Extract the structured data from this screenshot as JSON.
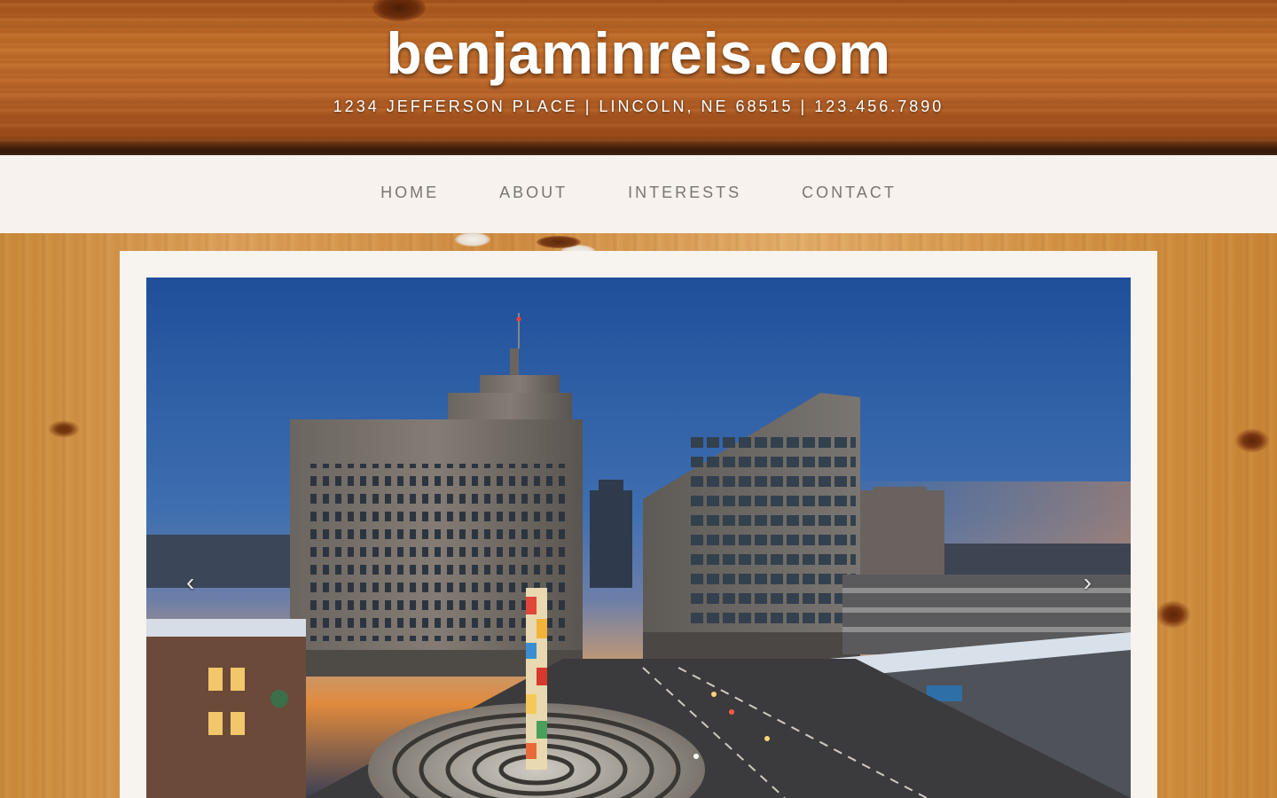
{
  "header": {
    "site_title": "benjaminreis.com",
    "address": "1234 JEFFERSON PLACE | LINCOLN, NE 68515 | 123.456.7890"
  },
  "nav": {
    "items": [
      {
        "label": "HOME"
      },
      {
        "label": "ABOUT"
      },
      {
        "label": "INTERESTS"
      },
      {
        "label": "CONTACT"
      }
    ]
  },
  "carousel": {
    "prev_glyph": "‹",
    "next_glyph": "›",
    "slide_icon": "city-skyline-photo"
  },
  "colors": {
    "nav_bg": "#f7f2ee",
    "nav_text": "#7a7570",
    "frame_bg": "#f7f3ef",
    "title_text": "#ffffff"
  }
}
